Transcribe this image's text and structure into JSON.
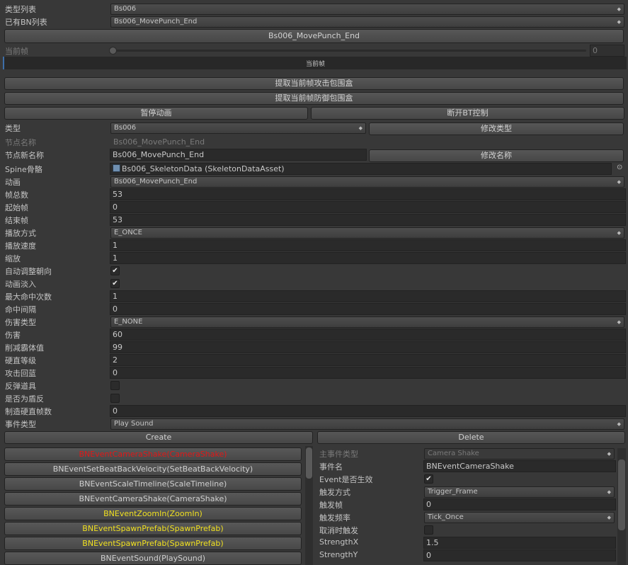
{
  "top": {
    "type_list_label": "类型列表",
    "type_list_value": "Bs006",
    "bn_list_label": "已有BN列表",
    "bn_list_value": "Bs006_MovePunch_End",
    "title_button": "Bs006_MovePunch_End",
    "current_frame_label": "当前帧",
    "current_frame_value": "0",
    "current_frame_fraction": 0,
    "timeline_label": "当前帧"
  },
  "actions": {
    "extract_attack_box": "提取当前帧攻击包围盒",
    "extract_defense_box": "提取当前帧防御包围盒",
    "pause_animation": "暂停动画",
    "disconnect_bt": "断开BT控制"
  },
  "props": {
    "type_label": "类型",
    "type_value": "Bs006",
    "modify_type": "修改类型",
    "node_name_label": "节点名称",
    "node_name_value": "Bs006_MovePunch_End",
    "node_new_name_label": "节点新名称",
    "node_new_name_value": "Bs006_MovePunch_End",
    "modify_name": "修改名称",
    "spine_label": "Spine骨骼",
    "spine_value": "Bs006_SkeletonData (SkeletonDataAsset)",
    "animation_label": "动画",
    "animation_value": "Bs006_MovePunch_End",
    "total_frames_label": "帧总数",
    "total_frames_value": "53",
    "start_frame_label": "起始帧",
    "start_frame_value": "0",
    "end_frame_label": "结束帧",
    "end_frame_value": "53",
    "play_mode_label": "播放方式",
    "play_mode_value": "E_ONCE",
    "play_speed_label": "播放速度",
    "play_speed_value": "1",
    "scale_label": "缩放",
    "scale_value": "1",
    "auto_face_label": "自动调整朝向",
    "auto_face_checked": true,
    "fade_label": "动画淡入",
    "fade_checked": true,
    "max_hits_label": "最大命中次数",
    "max_hits_value": "1",
    "hit_interval_label": "命中间隔",
    "hit_interval_value": "0",
    "damage_type_label": "伤害类型",
    "damage_type_value": "E_NONE",
    "damage_label": "伤害",
    "damage_value": "60",
    "reduce_hegemony_label": "削减霸体值",
    "reduce_hegemony_value": "99",
    "stiff_level_label": "硬直等级",
    "stiff_level_value": "2",
    "attack_mana_label": "攻击回蓝",
    "attack_mana_value": "0",
    "bounce_prop_label": "反弹道具",
    "bounce_prop_checked": false,
    "shield_reflect_label": "是否为盾反",
    "shield_reflect_checked": false,
    "make_stiff_label": "制造硬直帧数",
    "make_stiff_value": "0",
    "event_type_label": "事件类型",
    "event_type_value": "Play Sound"
  },
  "event_buttons": {
    "create": "Create",
    "delete": "Delete"
  },
  "event_list": [
    {
      "label": "BNEventCameraShake(CameraShake)",
      "color": "#e01818"
    },
    {
      "label": "BNEventSetBeatBackVelocity(SetBeatBackVelocity)",
      "color": "#d0d0d0"
    },
    {
      "label": "BNEventScaleTimeline(ScaleTimeline)",
      "color": "#d0d0d0"
    },
    {
      "label": "BNEventCameraShake(CameraShake)",
      "color": "#d0d0d0"
    },
    {
      "label": "BNEventZoomIn(ZoomIn)",
      "color": "#f0e020"
    },
    {
      "label": "BNEventSpawnPrefab(SpawnPrefab)",
      "color": "#f0e020"
    },
    {
      "label": "BNEventSpawnPrefab(SpawnPrefab)",
      "color": "#f0e020"
    },
    {
      "label": "BNEventSound(PlaySound)",
      "color": "#d0d0d0"
    }
  ],
  "event_detail": {
    "main_type_label": "主事件类型",
    "main_type_value": "Camera Shake",
    "event_name_label": "事件名",
    "event_name_value": "BNEventCameraShake",
    "event_active_label": "Event是否生效",
    "event_active_checked": true,
    "trigger_mode_label": "触发方式",
    "trigger_mode_value": "Trigger_Frame",
    "trigger_frame_label": "触发帧",
    "trigger_frame_value": "0",
    "trigger_freq_label": "触发频率",
    "trigger_freq_value": "Tick_Once",
    "cancel_trigger_label": "取消时触发",
    "cancel_trigger_checked": false,
    "strength_x_label": "StrengthX",
    "strength_x_value": "1.5",
    "strength_y_label": "StrengthY",
    "strength_y_value": "0"
  }
}
